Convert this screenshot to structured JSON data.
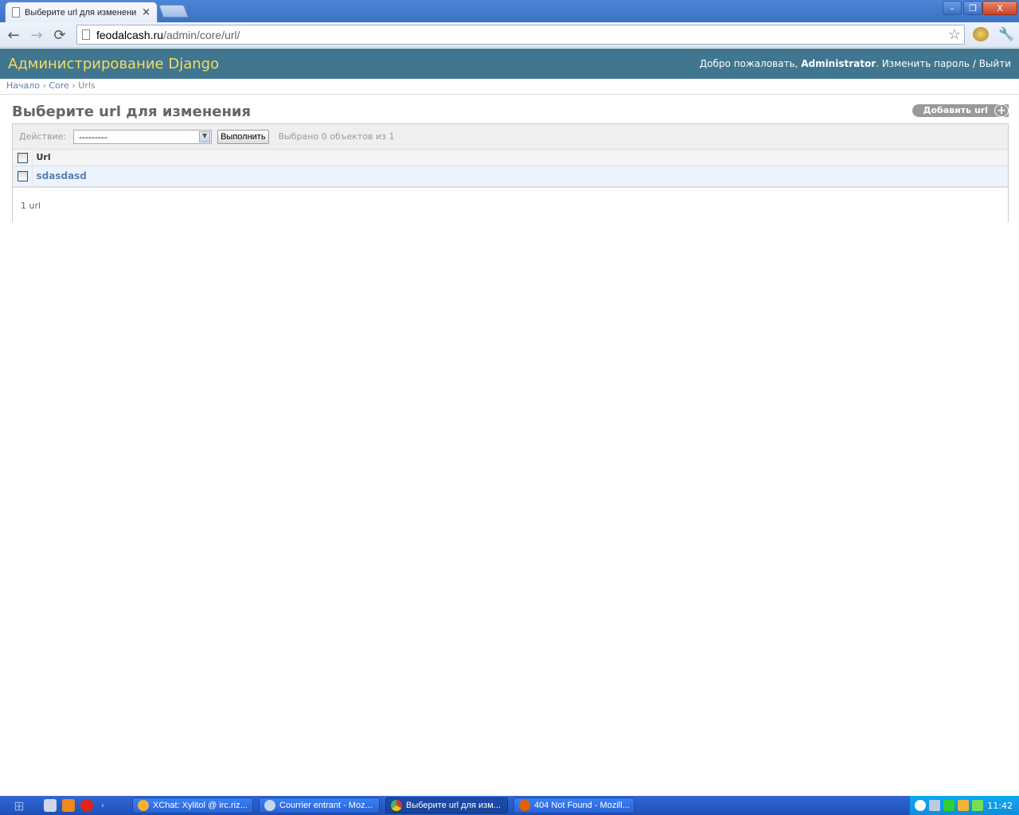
{
  "browser": {
    "tab_title": "Выберите url для изменени",
    "tab_close": "×",
    "url_host": "feodalcash.ru",
    "url_path": "/admin/core/url/",
    "back": "←",
    "forward": "→",
    "reload": "⟳",
    "star": "☆",
    "wrench": "🔧",
    "win_min": "–",
    "win_max": "❐",
    "win_close": "X"
  },
  "header": {
    "brand": "Администрирование Django",
    "welcome": "Добро пожаловать,",
    "username": "Administrator",
    "change_password": "Изменить пароль",
    "separator": "/",
    "logout": "Выйти"
  },
  "breadcrumbs": {
    "home": "Начало",
    "app": "Core",
    "model": "Urls",
    "sep": "›"
  },
  "page": {
    "title": "Выберите url для изменения",
    "add_button": "Добавить url",
    "add_plus": "+"
  },
  "actions": {
    "label": "Действие:",
    "selected_value": "---------",
    "go_button": "Выполнить",
    "counter": "Выбрано 0 объектов из 1"
  },
  "table": {
    "column_header": "Url",
    "rows": [
      {
        "value": "sdasdasd"
      }
    ],
    "paginator": "1 url"
  },
  "taskbar": {
    "items": [
      {
        "label": "XChat: Xylitol @ irc.riz...",
        "active": false
      },
      {
        "label": "Courrier entrant - Moz...",
        "active": false
      },
      {
        "label": "Выберите url для изм...",
        "active": true
      },
      {
        "label": "404 Not Found - Mozill...",
        "active": false
      }
    ],
    "clock": "11:42"
  },
  "colors": {
    "header_bg": "#417690",
    "brand_yellow": "#f5dd5d",
    "link_blue": "#5b80b2",
    "taskbar_blue": "#2a62d4"
  }
}
